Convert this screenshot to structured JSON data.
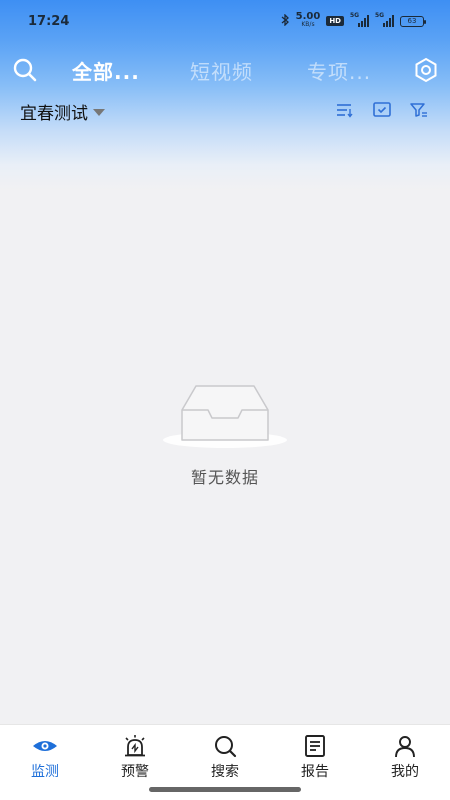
{
  "status_bar": {
    "time": "17:24",
    "net_speed": "5.00",
    "net_unit": "KB/s",
    "hd": "HD",
    "signal_tag": "5G",
    "battery": "63"
  },
  "top_nav": {
    "tabs": [
      {
        "label": "全部...",
        "active": true
      },
      {
        "label": "短视频",
        "active": false
      },
      {
        "label": "专项...",
        "active": false
      }
    ],
    "search_icon": "search-icon",
    "settings_icon": "settings-icon"
  },
  "filter_bar": {
    "region": "宜春测试",
    "icons": [
      "sort-icon",
      "check-square-icon",
      "filter-icon"
    ]
  },
  "empty_state": {
    "text": "暂无数据",
    "icon": "empty-inbox-icon"
  },
  "bottom_nav": {
    "items": [
      {
        "label": "监测",
        "icon": "monitor-icon",
        "active": true
      },
      {
        "label": "预警",
        "icon": "alarm-icon",
        "active": false
      },
      {
        "label": "搜索",
        "icon": "search-icon",
        "active": false
      },
      {
        "label": "报告",
        "icon": "report-icon",
        "active": false
      },
      {
        "label": "我的",
        "icon": "user-icon",
        "active": false
      }
    ]
  },
  "colors": {
    "header_top": "#3e8ff3",
    "accent": "#1e6fd9",
    "background": "#f1f1f3",
    "icon_blue": "#2f6fd6"
  }
}
